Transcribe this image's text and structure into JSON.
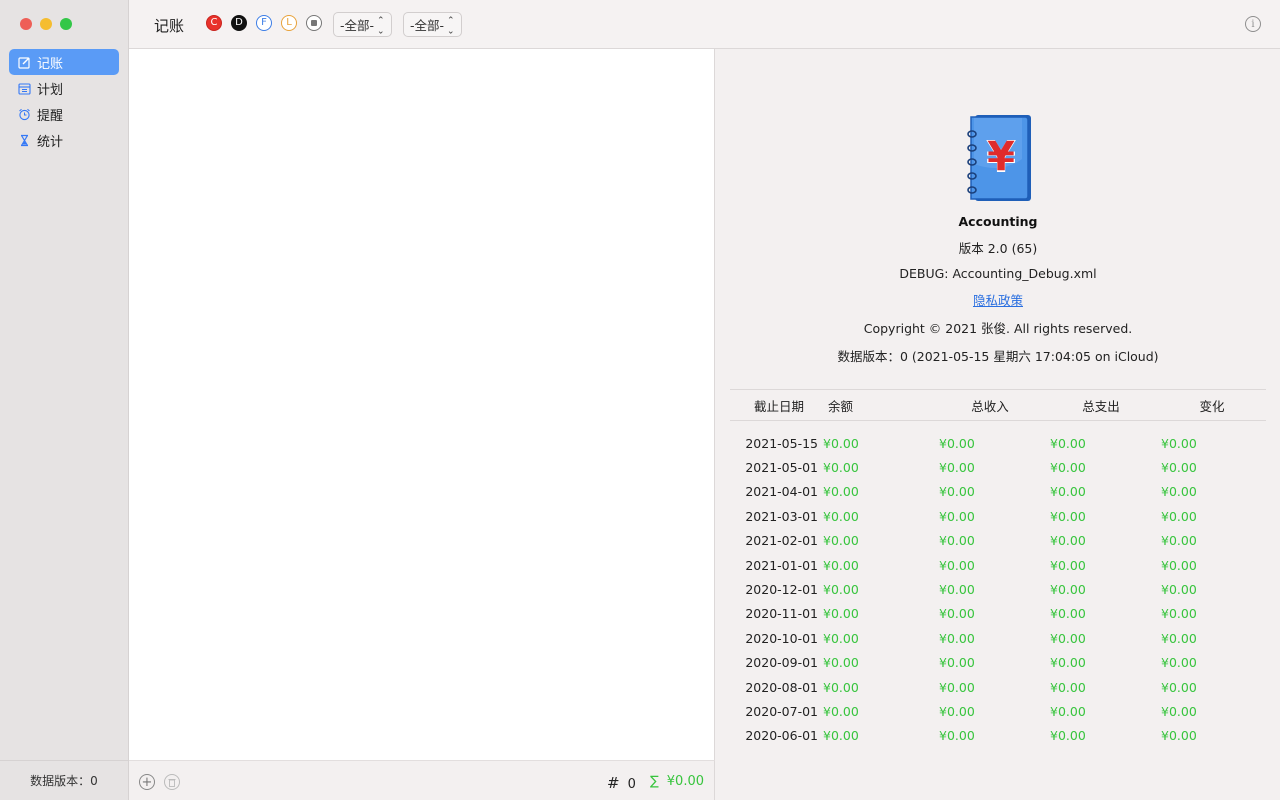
{
  "sidebar": {
    "items": [
      {
        "label": "记账",
        "icon": "edit-icon",
        "active": true
      },
      {
        "label": "计划",
        "icon": "calendar-icon",
        "active": false
      },
      {
        "label": "提醒",
        "icon": "alarm-icon",
        "active": false
      },
      {
        "label": "统计",
        "icon": "hourglass-icon",
        "active": false
      }
    ],
    "footer": "数据版本：0"
  },
  "toolbar": {
    "title": "记账",
    "filters": [
      {
        "letter": "C",
        "color": "#e8322b"
      },
      {
        "letter": "D",
        "color": "#111111"
      },
      {
        "letter": "F",
        "color": "#3d7ee6"
      },
      {
        "letter": "L",
        "color": "#e8a23a"
      },
      {
        "letter": "",
        "color": "#777777"
      }
    ],
    "popup1": "-全部-",
    "popup2": "-全部-",
    "info_icon": "info-icon"
  },
  "footer": {
    "count_symbol": "#",
    "count": "0",
    "sum_symbol": "∑",
    "sum": "¥0.00"
  },
  "about": {
    "app_name": "Accounting",
    "version": "版本 2.0 (65)",
    "debug": "DEBUG: Accounting_Debug.xml",
    "privacy": "隐私政策",
    "copyright": "Copyright © 2021 张俊. All rights reserved.",
    "data_version": "数据版本：0  (2021-05-15 星期六 17:04:05 on iCloud)",
    "icon_symbol": "¥"
  },
  "stats": {
    "headers": [
      "截止日期",
      "余额",
      "总收入",
      "总支出",
      "变化"
    ],
    "rows": [
      [
        "2021-05-15",
        "¥0.00",
        "¥0.00",
        "¥0.00",
        "¥0.00"
      ],
      [
        "2021-05-01",
        "¥0.00",
        "¥0.00",
        "¥0.00",
        "¥0.00"
      ],
      [
        "2021-04-01",
        "¥0.00",
        "¥0.00",
        "¥0.00",
        "¥0.00"
      ],
      [
        "2021-03-01",
        "¥0.00",
        "¥0.00",
        "¥0.00",
        "¥0.00"
      ],
      [
        "2021-02-01",
        "¥0.00",
        "¥0.00",
        "¥0.00",
        "¥0.00"
      ],
      [
        "2021-01-01",
        "¥0.00",
        "¥0.00",
        "¥0.00",
        "¥0.00"
      ],
      [
        "2020-12-01",
        "¥0.00",
        "¥0.00",
        "¥0.00",
        "¥0.00"
      ],
      [
        "2020-11-01",
        "¥0.00",
        "¥0.00",
        "¥0.00",
        "¥0.00"
      ],
      [
        "2020-10-01",
        "¥0.00",
        "¥0.00",
        "¥0.00",
        "¥0.00"
      ],
      [
        "2020-09-01",
        "¥0.00",
        "¥0.00",
        "¥0.00",
        "¥0.00"
      ],
      [
        "2020-08-01",
        "¥0.00",
        "¥0.00",
        "¥0.00",
        "¥0.00"
      ],
      [
        "2020-07-01",
        "¥0.00",
        "¥0.00",
        "¥0.00",
        "¥0.00"
      ],
      [
        "2020-06-01",
        "¥0.00",
        "¥0.00",
        "¥0.00",
        "¥0.00"
      ]
    ]
  },
  "colors": {
    "accent": "#5a9bf6",
    "money_green": "#37c43d",
    "link": "#2a6fe0"
  }
}
